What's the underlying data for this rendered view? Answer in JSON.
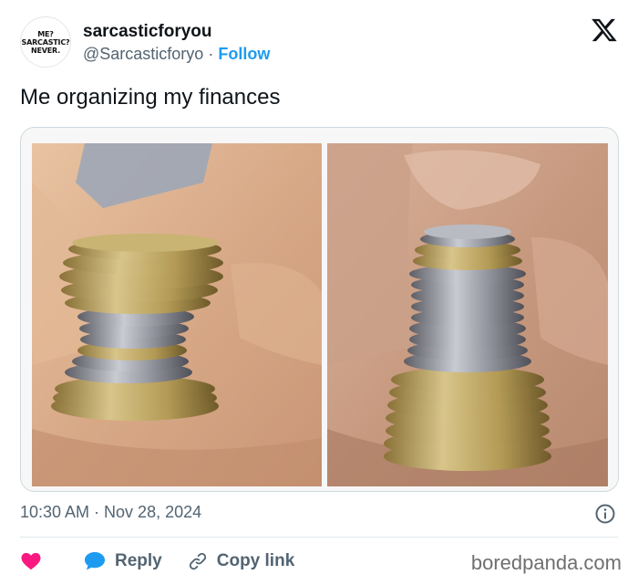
{
  "author": {
    "avatar_lines": [
      "ME?",
      "SARCASTIC?",
      "NEVER."
    ],
    "display_name": "sarcasticforyou",
    "handle": "@Sarcasticforyo",
    "separator": "·",
    "follow_label": "Follow"
  },
  "tweet": {
    "text": "Me organizing my finances",
    "timestamp": "10:30 AM · Nov 28, 2024"
  },
  "actions": {
    "reply_label": "Reply",
    "copy_link_label": "Copy link"
  },
  "watermark": "boredpanda.com",
  "icons": [
    "x-logo-icon",
    "info-icon",
    "heart-icon",
    "reply-bubble-icon",
    "link-icon"
  ],
  "colors": {
    "accent": "#1d9bf0",
    "heart": "#f91880",
    "muted": "#536471"
  }
}
